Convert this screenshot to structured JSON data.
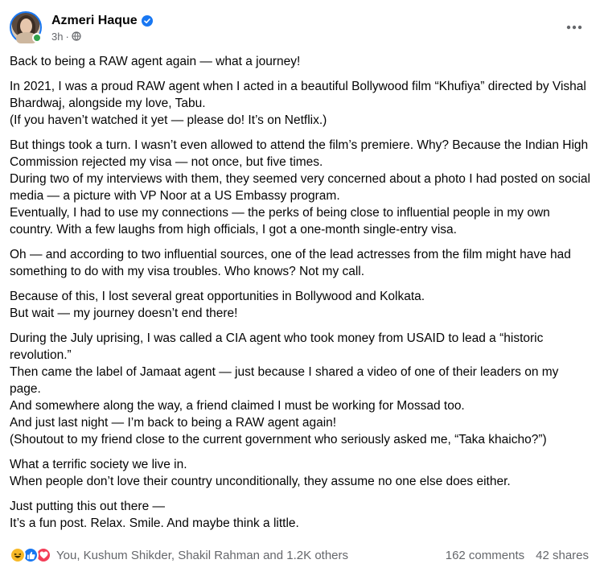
{
  "post": {
    "author": "Azmeri Haque",
    "time": "3h",
    "time_separator": "·",
    "paragraphs": [
      [
        "Back to being a RAW agent again — what a journey!"
      ],
      [
        "In 2021, I was a proud RAW agent when I acted in a beautiful Bollywood film “Khufiya” directed by Vishal Bhardwaj, alongside my love, Tabu.",
        "(If you haven’t watched it yet — please do! It’s on Netflix.)"
      ],
      [
        "But things took a turn. I wasn’t even allowed to attend the film’s premiere. Why? Because the Indian High Commission rejected my visa — not once, but five times.",
        "During two of my interviews with them, they seemed very concerned about a photo I had posted on social media — a picture with VP Noor at a US Embassy program.",
        "Eventually, I had to use my connections — the perks of being close to influential people in my own country. With a few laughs from high officials, I got a one-month single-entry visa."
      ],
      [
        "Oh — and according to two influential sources, one of the lead actresses from the film might have had something to do with my visa troubles. Who knows? Not my call."
      ],
      [
        "Because of this, I lost several great opportunities in Bollywood and Kolkata.",
        "But wait — my journey doesn’t end there!"
      ],
      [
        "During the July uprising, I was called a CIA agent who took money from USAID to lead a “historic revolution.”",
        "Then came the label of Jamaat agent — just because I shared a video of one of their leaders on my page.",
        "And somewhere along the way, a friend claimed I must be working for Mossad too.",
        "And just last night — I’m back to being a RAW agent again!",
        "(Shoutout to my friend close to the current government who seriously asked me, “Taka khaicho?”)"
      ],
      [
        "What a terrific society we live in.",
        "When people don’t love their country unconditionally, they assume no one else does either."
      ],
      [
        "Just putting this out there —",
        "It’s a fun post. Relax. Smile. And maybe think a little."
      ]
    ]
  },
  "footer": {
    "reactors": "You, Kushum Shikder, Shakil Rahman and 1.2K others",
    "comments": "162 comments",
    "shares": "42 shares"
  },
  "colors": {
    "verified": "#1877f2",
    "online": "#31a24c",
    "meta_text": "#65676b",
    "haha": "#f7b928",
    "like": "#1877f2",
    "love": "#f33e58"
  },
  "icons": [
    "verified-badge-icon",
    "globe-icon",
    "more-options-icon",
    "haha-reaction-icon",
    "like-reaction-icon",
    "love-reaction-icon"
  ]
}
